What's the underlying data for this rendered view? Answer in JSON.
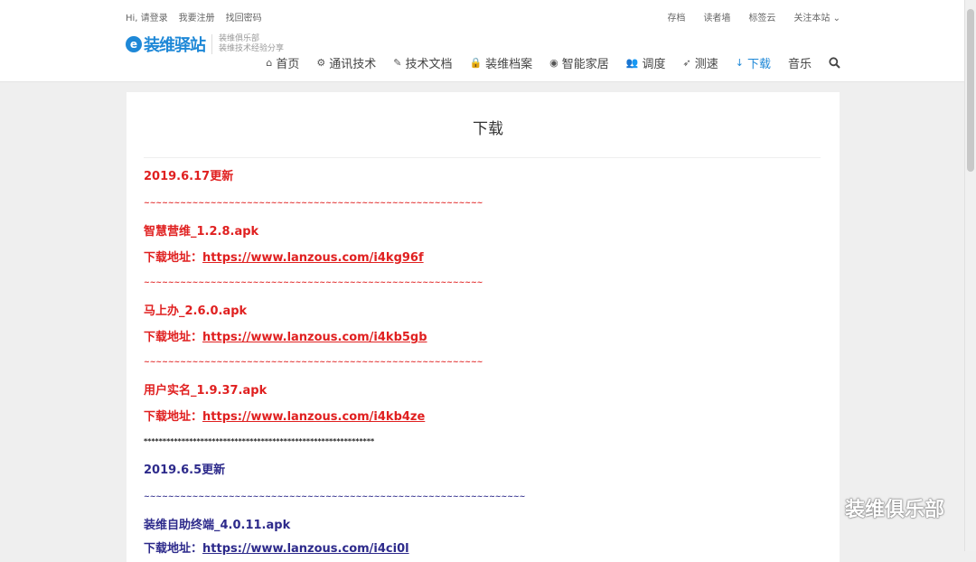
{
  "header": {
    "top_left_links": [
      "Hi, 请登录",
      "我要注册",
      "找回密码"
    ],
    "top_right_links": [
      "存档",
      "读者墙",
      "标签云",
      "关注本站 ⌄"
    ],
    "logo": {
      "mark": "e",
      "text": "装维驿站",
      "sub1": "装维俱乐部",
      "sub2": "装维技术经验分享"
    },
    "nav": [
      {
        "icon": "home-icon",
        "glyph": "⌂",
        "label": "首页"
      },
      {
        "icon": "cogs-icon",
        "glyph": "⚙",
        "label": "通讯技术"
      },
      {
        "icon": "edit-icon",
        "glyph": "✎",
        "label": "技术文档"
      },
      {
        "icon": "lock-icon",
        "glyph": "🔒",
        "label": "装维档案"
      },
      {
        "icon": "dot-circle-icon",
        "glyph": "◉",
        "label": "智能家居"
      },
      {
        "icon": "users-icon",
        "glyph": "👥",
        "label": "调度"
      },
      {
        "icon": "rocket-icon",
        "glyph": "➶",
        "label": "测速"
      },
      {
        "icon": "download-icon",
        "glyph": "↓",
        "label": "下载",
        "active": true
      },
      {
        "icon": "",
        "glyph": "",
        "label": "音乐"
      }
    ],
    "search_icon": "search-icon"
  },
  "page": {
    "title": "下载"
  },
  "content": {
    "lines": [
      {
        "text": "2019.6.17更新",
        "color": "red",
        "sep": false
      },
      {
        "text": "~~~~~~~~~~~~~~~~~~~~~~~~~~~~~~~~~~~~~~~~~~~~~~~~~~~~~~~~",
        "color": "red",
        "sep": true
      },
      {
        "text": "智慧营维_1.2.8.apk",
        "color": "red",
        "sep": false
      },
      {
        "text": "下载地址：",
        "link": "https://www.lanzous.com/i4kg96f",
        "color": "red",
        "sep": false
      },
      {
        "text": "~~~~~~~~~~~~~~~~~~~~~~~~~~~~~~~~~~~~~~~~~~~~~~~~~~~~~~~~",
        "color": "red",
        "sep": true
      },
      {
        "text": "马上办_2.6.0.apk",
        "color": "red",
        "sep": false
      },
      {
        "text": "下载地址：",
        "link": "https://www.lanzous.com/i4kb5gb",
        "color": "red",
        "sep": false
      },
      {
        "text": "~~~~~~~~~~~~~~~~~~~~~~~~~~~~~~~~~~~~~~~~~~~~~~~~~~~~~~~~",
        "color": "red",
        "sep": true
      },
      {
        "text": "用户实名_1.9.37.apk",
        "color": "red",
        "sep": false
      },
      {
        "text": "下载地址：",
        "link": "https://www.lanzous.com/i4kb4ze",
        "color": "red",
        "sep": false
      },
      {
        "text": "*************************************************************",
        "color": "black",
        "sep": true
      },
      {
        "text": "2019.6.5更新",
        "color": "navy",
        "sep": false
      },
      {
        "text": "~~~~~~~~~~~~~~~~~~~~~~~~~~~~~~~~~~~~~~~~~~~~~~~~~~~~~~~~~~~~~~~",
        "color": "navy",
        "sep": true
      },
      {
        "text": "装维自助终端_4.0.11.apk",
        "color": "navy",
        "sep": false
      },
      {
        "text": "下载地址：",
        "link": "https://www.lanzous.com/i4ci0l",
        "color": "navy",
        "sep": false
      }
    ]
  },
  "watermark": {
    "text": "装维俱乐部",
    "icon": "wechat-icon"
  }
}
